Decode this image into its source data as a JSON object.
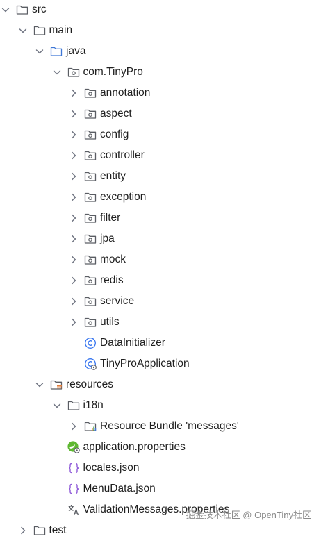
{
  "tree": {
    "items": [
      {
        "label": "src",
        "depth": 0,
        "arrow": "down",
        "icon": "folder-icon"
      },
      {
        "label": "main",
        "depth": 1,
        "arrow": "down",
        "icon": "folder-icon"
      },
      {
        "label": "java",
        "depth": 2,
        "arrow": "down",
        "icon": "source-folder-icon"
      },
      {
        "label": "com.TinyPro",
        "depth": 3,
        "arrow": "down",
        "icon": "package-icon"
      },
      {
        "label": "annotation",
        "depth": 4,
        "arrow": "right",
        "icon": "package-icon"
      },
      {
        "label": "aspect",
        "depth": 4,
        "arrow": "right",
        "icon": "package-icon"
      },
      {
        "label": "config",
        "depth": 4,
        "arrow": "right",
        "icon": "package-icon"
      },
      {
        "label": "controller",
        "depth": 4,
        "arrow": "right",
        "icon": "package-icon"
      },
      {
        "label": "entity",
        "depth": 4,
        "arrow": "right",
        "icon": "package-icon"
      },
      {
        "label": "exception",
        "depth": 4,
        "arrow": "right",
        "icon": "package-icon"
      },
      {
        "label": "filter",
        "depth": 4,
        "arrow": "right",
        "icon": "package-icon"
      },
      {
        "label": "jpa",
        "depth": 4,
        "arrow": "right",
        "icon": "package-icon"
      },
      {
        "label": "mock",
        "depth": 4,
        "arrow": "right",
        "icon": "package-icon"
      },
      {
        "label": "redis",
        "depth": 4,
        "arrow": "right",
        "icon": "package-icon"
      },
      {
        "label": "service",
        "depth": 4,
        "arrow": "right",
        "icon": "package-icon"
      },
      {
        "label": "utils",
        "depth": 4,
        "arrow": "right",
        "icon": "package-icon"
      },
      {
        "label": "DataInitializer",
        "depth": 4,
        "arrow": "none",
        "icon": "java-class-icon"
      },
      {
        "label": "TinyProApplication",
        "depth": 4,
        "arrow": "none",
        "icon": "spring-boot-class-icon"
      },
      {
        "label": "resources",
        "depth": 2,
        "arrow": "down",
        "icon": "resources-folder-icon"
      },
      {
        "label": "i18n",
        "depth": 3,
        "arrow": "down",
        "icon": "folder-icon"
      },
      {
        "label": "Resource Bundle 'messages'",
        "depth": 4,
        "arrow": "right",
        "icon": "resource-bundle-icon"
      },
      {
        "label": "application.properties",
        "depth": 3,
        "arrow": "none",
        "icon": "spring-properties-icon"
      },
      {
        "label": "locales.json",
        "depth": 3,
        "arrow": "none",
        "icon": "json-file-icon"
      },
      {
        "label": "MenuData.json",
        "depth": 3,
        "arrow": "none",
        "icon": "json-file-icon"
      },
      {
        "label": "ValidationMessages.properties",
        "depth": 3,
        "arrow": "none",
        "icon": "properties-translate-icon"
      },
      {
        "label": "test",
        "depth": 1,
        "arrow": "right",
        "icon": "folder-icon"
      }
    ]
  },
  "watermark": "掘金技术社区 @ OpenTiny社区",
  "colors": {
    "icon_stroke": "#5a5d63",
    "spring_green": "#5fb832",
    "class_blue": "#3574f0",
    "json_purple": "#8f5ad8",
    "resource_orange": "#e07b39"
  }
}
